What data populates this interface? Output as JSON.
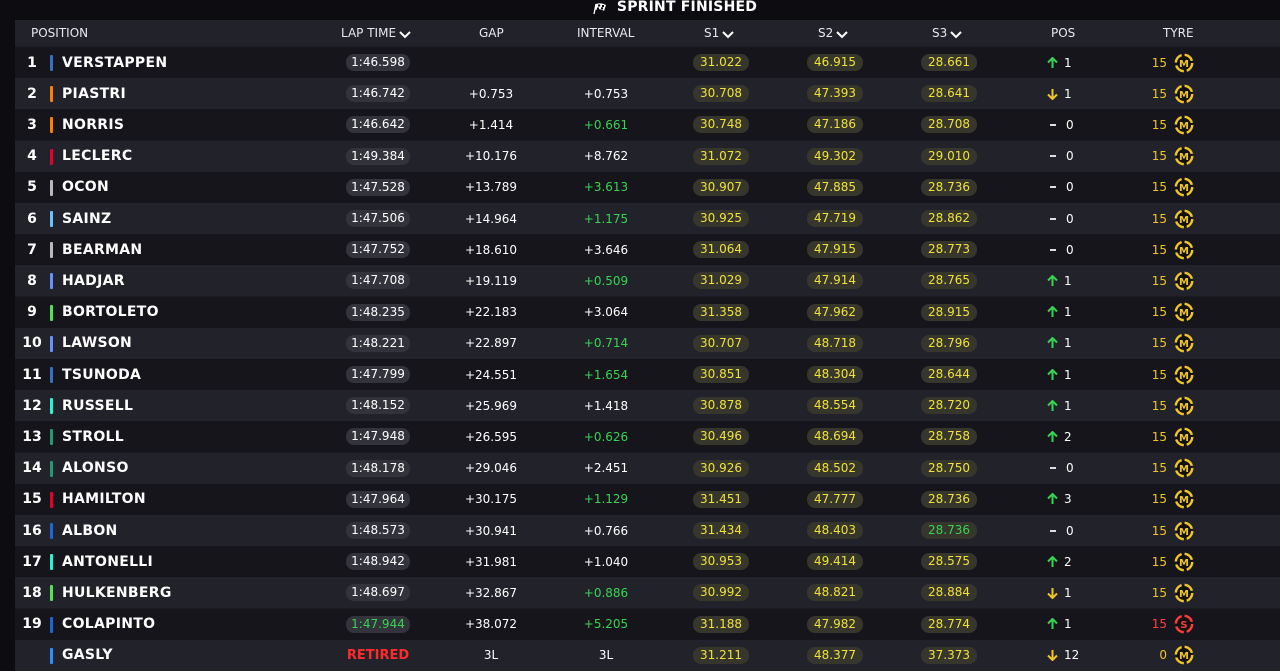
{
  "title": "SPRINT FINISHED",
  "headers": {
    "position": "POSITION",
    "lap_time": "LAP TIME",
    "gap": "GAP",
    "interval": "INTERVAL",
    "s1": "S1",
    "s2": "S2",
    "s3": "S3",
    "pos": "POS",
    "tyre": "TYRE"
  },
  "colors": {
    "sector_yellow": "#f0e23a",
    "green": "#39d353",
    "retired_red": "#ff2b2b",
    "up_arrow": "#39d353",
    "down_arrow": "#f0c528",
    "tyre_medium": "#f0c528",
    "tyre_soft": "#ff3b3b"
  },
  "rows": [
    {
      "pos": "1",
      "name": "VERSTAPPEN",
      "team_color": "#3671c6",
      "lap": "1:46.598",
      "lap_green": false,
      "gap": "",
      "interval": "",
      "interval_green": false,
      "s1": "31.022",
      "s2": "46.915",
      "s3": "28.661",
      "s3_green": false,
      "change": "up",
      "change_val": "1",
      "tyre_laps": "15",
      "tyre": "M",
      "tyre_icon": "medium-tyre-icon"
    },
    {
      "pos": "2",
      "name": "PIASTRI",
      "team_color": "#ff8000",
      "lap": "1:46.742",
      "lap_green": false,
      "gap": "+0.753",
      "interval": "+0.753",
      "interval_green": false,
      "s1": "30.708",
      "s2": "47.393",
      "s3": "28.641",
      "s3_green": false,
      "change": "down",
      "change_val": "1",
      "tyre_laps": "15",
      "tyre": "M",
      "tyre_icon": "medium-tyre-icon"
    },
    {
      "pos": "3",
      "name": "NORRIS",
      "team_color": "#ff8000",
      "lap": "1:46.642",
      "lap_green": false,
      "gap": "+1.414",
      "interval": "+0.661",
      "interval_green": true,
      "s1": "30.748",
      "s2": "47.186",
      "s3": "28.708",
      "s3_green": false,
      "change": "same",
      "change_val": "0",
      "tyre_laps": "15",
      "tyre": "M",
      "tyre_icon": "medium-tyre-icon"
    },
    {
      "pos": "4",
      "name": "LECLERC",
      "team_color": "#e8002d",
      "lap": "1:49.384",
      "lap_green": false,
      "gap": "+10.176",
      "interval": "+8.762",
      "interval_green": false,
      "s1": "31.072",
      "s2": "49.302",
      "s3": "29.010",
      "s3_green": false,
      "change": "same",
      "change_val": "0",
      "tyre_laps": "15",
      "tyre": "M",
      "tyre_icon": "medium-tyre-icon"
    },
    {
      "pos": "5",
      "name": "OCON",
      "team_color": "#b6babd",
      "lap": "1:47.528",
      "lap_green": false,
      "gap": "+13.789",
      "interval": "+3.613",
      "interval_green": true,
      "s1": "30.907",
      "s2": "47.885",
      "s3": "28.736",
      "s3_green": false,
      "change": "same",
      "change_val": "0",
      "tyre_laps": "15",
      "tyre": "M",
      "tyre_icon": "medium-tyre-icon"
    },
    {
      "pos": "6",
      "name": "SAINZ",
      "team_color": "#64c4ff",
      "lap": "1:47.506",
      "lap_green": false,
      "gap": "+14.964",
      "interval": "+1.175",
      "interval_green": true,
      "s1": "30.925",
      "s2": "47.719",
      "s3": "28.862",
      "s3_green": false,
      "change": "same",
      "change_val": "0",
      "tyre_laps": "15",
      "tyre": "M",
      "tyre_icon": "medium-tyre-icon"
    },
    {
      "pos": "7",
      "name": "BEARMAN",
      "team_color": "#b6babd",
      "lap": "1:47.752",
      "lap_green": false,
      "gap": "+18.610",
      "interval": "+3.646",
      "interval_green": false,
      "s1": "31.064",
      "s2": "47.915",
      "s3": "28.773",
      "s3_green": false,
      "change": "same",
      "change_val": "0",
      "tyre_laps": "15",
      "tyre": "M",
      "tyre_icon": "medium-tyre-icon"
    },
    {
      "pos": "8",
      "name": "HADJAR",
      "team_color": "#6692ff",
      "lap": "1:47.708",
      "lap_green": false,
      "gap": "+19.119",
      "interval": "+0.509",
      "interval_green": true,
      "s1": "31.029",
      "s2": "47.914",
      "s3": "28.765",
      "s3_green": false,
      "change": "up",
      "change_val": "1",
      "tyre_laps": "15",
      "tyre": "M",
      "tyre_icon": "medium-tyre-icon"
    },
    {
      "pos": "9",
      "name": "BORTOLETO",
      "team_color": "#52e252",
      "lap": "1:48.235",
      "lap_green": false,
      "gap": "+22.183",
      "interval": "+3.064",
      "interval_green": false,
      "s1": "31.358",
      "s2": "47.962",
      "s3": "28.915",
      "s3_green": false,
      "change": "up",
      "change_val": "1",
      "tyre_laps": "15",
      "tyre": "M",
      "tyre_icon": "medium-tyre-icon"
    },
    {
      "pos": "10",
      "name": "LAWSON",
      "team_color": "#6692ff",
      "lap": "1:48.221",
      "lap_green": false,
      "gap": "+22.897",
      "interval": "+0.714",
      "interval_green": true,
      "s1": "30.707",
      "s2": "48.718",
      "s3": "28.796",
      "s3_green": false,
      "change": "up",
      "change_val": "1",
      "tyre_laps": "15",
      "tyre": "M",
      "tyre_icon": "medium-tyre-icon"
    },
    {
      "pos": "11",
      "name": "TSUNODA",
      "team_color": "#3671c6",
      "lap": "1:47.799",
      "lap_green": false,
      "gap": "+24.551",
      "interval": "+1.654",
      "interval_green": true,
      "s1": "30.851",
      "s2": "48.304",
      "s3": "28.644",
      "s3_green": false,
      "change": "up",
      "change_val": "1",
      "tyre_laps": "15",
      "tyre": "M",
      "tyre_icon": "medium-tyre-icon"
    },
    {
      "pos": "12",
      "name": "RUSSELL",
      "team_color": "#27f4d2",
      "lap": "1:48.152",
      "lap_green": false,
      "gap": "+25.969",
      "interval": "+1.418",
      "interval_green": false,
      "s1": "30.878",
      "s2": "48.554",
      "s3": "28.720",
      "s3_green": false,
      "change": "up",
      "change_val": "1",
      "tyre_laps": "15",
      "tyre": "M",
      "tyre_icon": "medium-tyre-icon"
    },
    {
      "pos": "13",
      "name": "STROLL",
      "team_color": "#229971",
      "lap": "1:47.948",
      "lap_green": false,
      "gap": "+26.595",
      "interval": "+0.626",
      "interval_green": true,
      "s1": "30.496",
      "s2": "48.694",
      "s3": "28.758",
      "s3_green": false,
      "change": "up",
      "change_val": "2",
      "tyre_laps": "15",
      "tyre": "M",
      "tyre_icon": "medium-tyre-icon"
    },
    {
      "pos": "14",
      "name": "ALONSO",
      "team_color": "#229971",
      "lap": "1:48.178",
      "lap_green": false,
      "gap": "+29.046",
      "interval": "+2.451",
      "interval_green": false,
      "s1": "30.926",
      "s2": "48.502",
      "s3": "28.750",
      "s3_green": false,
      "change": "same",
      "change_val": "0",
      "tyre_laps": "15",
      "tyre": "M",
      "tyre_icon": "medium-tyre-icon"
    },
    {
      "pos": "15",
      "name": "HAMILTON",
      "team_color": "#e8002d",
      "lap": "1:47.964",
      "lap_green": false,
      "gap": "+30.175",
      "interval": "+1.129",
      "interval_green": true,
      "s1": "31.451",
      "s2": "47.777",
      "s3": "28.736",
      "s3_green": false,
      "change": "up",
      "change_val": "3",
      "tyre_laps": "15",
      "tyre": "M",
      "tyre_icon": "medium-tyre-icon"
    },
    {
      "pos": "16",
      "name": "ALBON",
      "team_color": "#1868db",
      "lap": "1:48.573",
      "lap_green": false,
      "gap": "+30.941",
      "interval": "+0.766",
      "interval_green": false,
      "s1": "31.434",
      "s2": "48.403",
      "s3": "28.736",
      "s3_green": true,
      "change": "same",
      "change_val": "0",
      "tyre_laps": "15",
      "tyre": "M",
      "tyre_icon": "medium-tyre-icon"
    },
    {
      "pos": "17",
      "name": "ANTONELLI",
      "team_color": "#27f4d2",
      "lap": "1:48.942",
      "lap_green": false,
      "gap": "+31.981",
      "interval": "+1.040",
      "interval_green": false,
      "s1": "30.953",
      "s2": "49.414",
      "s3": "28.575",
      "s3_green": false,
      "change": "up",
      "change_val": "2",
      "tyre_laps": "15",
      "tyre": "M",
      "tyre_icon": "medium-tyre-icon"
    },
    {
      "pos": "18",
      "name": "HULKENBERG",
      "team_color": "#52e252",
      "lap": "1:48.697",
      "lap_green": false,
      "gap": "+32.867",
      "interval": "+0.886",
      "interval_green": true,
      "s1": "30.992",
      "s2": "48.821",
      "s3": "28.884",
      "s3_green": false,
      "change": "down",
      "change_val": "1",
      "tyre_laps": "15",
      "tyre": "M",
      "tyre_icon": "medium-tyre-icon"
    },
    {
      "pos": "19",
      "name": "COLAPINTO",
      "team_color": "#1868db",
      "lap": "1:47.944",
      "lap_green": true,
      "gap": "+38.072",
      "interval": "+5.205",
      "interval_green": true,
      "s1": "31.188",
      "s2": "47.982",
      "s3": "28.774",
      "s3_green": false,
      "change": "up",
      "change_val": "1",
      "tyre_laps": "15",
      "tyre": "S",
      "tyre_icon": "soft-tyre-icon"
    },
    {
      "pos": "",
      "name": "GASLY",
      "team_color": "#2a8fff",
      "lap": "RETIRED",
      "lap_retired": true,
      "lap_green": false,
      "gap": "3L",
      "interval": "3L",
      "interval_green": false,
      "s1": "31.211",
      "s2": "48.377",
      "s3": "37.373",
      "s3_green": false,
      "change": "down",
      "change_val": "12",
      "tyre_laps": "0",
      "tyre": "M",
      "tyre_icon": "medium-tyre-icon"
    }
  ]
}
